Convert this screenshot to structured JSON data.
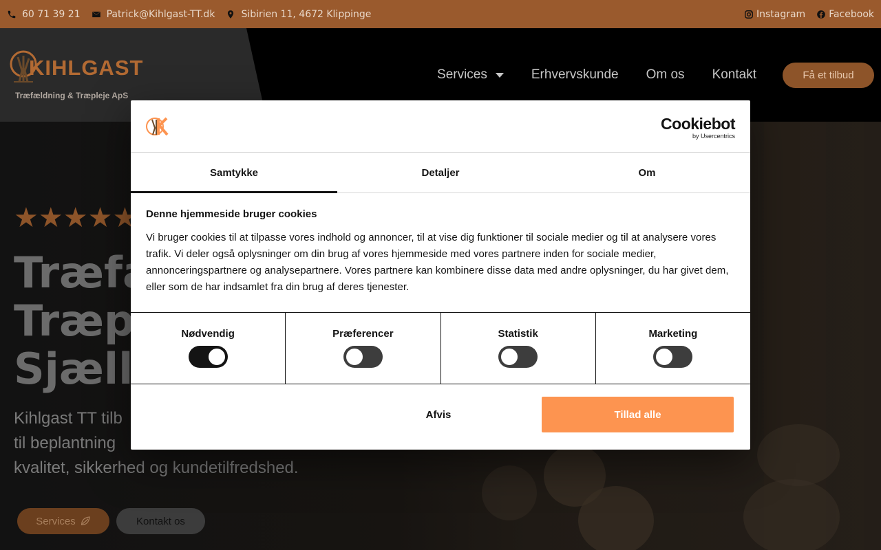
{
  "topbar": {
    "phone": "60 71 39 21",
    "email": "Patrick@Kihlgast-TT.dk",
    "address": "Sibirien 11, 4672 Klippinge",
    "instagram": "Instagram",
    "facebook": "Facebook"
  },
  "brand": {
    "name": "KIHLGAST",
    "tagline": "Træfældning & Træpleje ApS"
  },
  "nav": {
    "items": [
      {
        "label": "Services"
      },
      {
        "label": "Erhvervskunde"
      },
      {
        "label": "Om os"
      },
      {
        "label": "Kontakt"
      }
    ],
    "cta": "Få et tilbud"
  },
  "hero": {
    "stars": "★★★★★",
    "rating": 5,
    "title_lines": [
      "Træfæ",
      "Træpl",
      "Sjælla"
    ],
    "text": "Kihlgast TT tilb til beplantning kvalitet, sikkerhed og kundetilfredshed.",
    "text_lines": [
      "Kihlgast TT tilb",
      "til beplantning",
      "kvalitet, sikkerhed og kundetilfredshed."
    ],
    "btn_services": "Services",
    "btn_contact": "Kontakt os"
  },
  "cookie": {
    "brand_main": "Cookiebot",
    "brand_sub": "by Usercentrics",
    "tabs": [
      {
        "label": "Samtykke",
        "active": true
      },
      {
        "label": "Detaljer",
        "active": false
      },
      {
        "label": "Om",
        "active": false
      }
    ],
    "heading": "Denne hjemmeside bruger cookies",
    "body": "Vi bruger cookies til at tilpasse vores indhold og annoncer, til at vise dig funktioner til sociale medier og til at analysere vores trafik. Vi deler også oplysninger om din brug af vores hjemmeside med vores partnere inden for sociale medier, annonceringspartnere og analysepartnere. Vores partnere kan kombinere disse data med andre oplysninger, du har givet dem, eller som de har indsamlet fra din brug af deres tjenester.",
    "categories": [
      {
        "label": "Nødvendig",
        "enabled": true
      },
      {
        "label": "Præferencer",
        "enabled": false
      },
      {
        "label": "Statistik",
        "enabled": false
      },
      {
        "label": "Marketing",
        "enabled": false
      }
    ],
    "reject": "Afvis",
    "allow": "Tillad alle"
  },
  "colors": {
    "topbar": "#9a5a2d",
    "accent": "#fd9450",
    "brand_brown": "#8d5429"
  }
}
